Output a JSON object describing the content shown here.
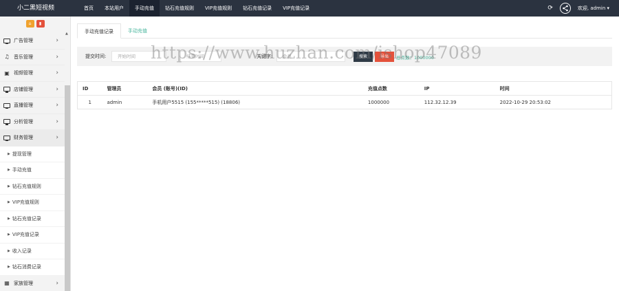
{
  "app": {
    "brand": "小二黑短视频"
  },
  "topnav": {
    "items": [
      {
        "label": "首页",
        "active": false
      },
      {
        "label": "本站用户",
        "active": false
      },
      {
        "label": "手动充值",
        "active": true
      },
      {
        "label": "钻石充值规则",
        "active": false
      },
      {
        "label": "VIP充值规则",
        "active": false
      },
      {
        "label": "钻石充值记录",
        "active": false
      },
      {
        "label": "VIP充值记录",
        "active": false
      }
    ],
    "refresh_icon": "refresh-icon",
    "share_icon": "share-icon",
    "welcome": "欢迎, admin ▾"
  },
  "sidebar": {
    "tools": [
      "home-icon",
      "delete-icon"
    ],
    "menu": [
      {
        "label": "广告管理",
        "icon": "monitor-icon"
      },
      {
        "label": "音乐管理",
        "icon": "music-icon"
      },
      {
        "label": "视频管理",
        "icon": "video-icon"
      },
      {
        "label": "店铺管理",
        "icon": "monitor-icon"
      },
      {
        "label": "直播管理",
        "icon": "monitor-icon"
      },
      {
        "label": "分析管理",
        "icon": "monitor-icon"
      },
      {
        "label": "财务管理",
        "icon": "monitor-icon"
      }
    ],
    "submenu": [
      "提现管理",
      "手动充值",
      "钻石充值规则",
      "VIP充值规则",
      "钻石充值记录",
      "VIP充值记录",
      "收入记录",
      "钻石消费记录"
    ],
    "last_partial": "家族管理"
  },
  "tabs": [
    {
      "label": "手动充值记录",
      "active": true
    },
    {
      "label": "手动充值",
      "active": false
    }
  ],
  "filter": {
    "time_label": "提交时间:",
    "start_placeholder": "开始时间",
    "end_placeholder": "结束时间",
    "keyword_label": "关键字:",
    "keyword_placeholder": "会员",
    "search_button": "搜索",
    "export_button": "导出",
    "total_text": "总点数：1000000"
  },
  "table": {
    "columns": [
      "ID",
      "管理员",
      "会员 (账号)(ID)",
      "充值点数",
      "IP",
      "时间"
    ],
    "rows": [
      [
        "1",
        "admin",
        "手机用户5515 (155*****515) (18806)",
        "1000000",
        "112.32.12.39",
        "2022-10-29 20:53:02"
      ]
    ]
  },
  "watermark": "https://www.huzhan.com/ishop47089"
}
